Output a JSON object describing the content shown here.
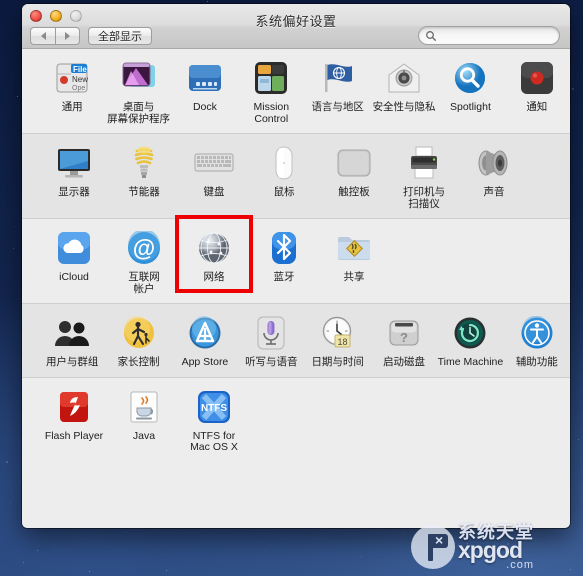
{
  "window": {
    "title": "系统偏好设置",
    "traffic_lights": [
      "close-button",
      "minimize-button",
      "zoom-button"
    ],
    "back_label": "◀",
    "forward_label": "▶",
    "show_all_label": "全部显示",
    "search_placeholder": "",
    "search_value": ""
  },
  "highlight": {
    "color": "#ef0000",
    "target": "网络"
  },
  "rows": [
    {
      "id": "personal",
      "items": [
        {
          "label": "通用",
          "icon": "general-icon"
        },
        {
          "label": "桌面与\n屏幕保护程序",
          "icon": "desktop-screensaver-icon"
        },
        {
          "label": "Dock",
          "icon": "dock-icon"
        },
        {
          "label": "Mission\nControl",
          "icon": "mission-control-icon"
        },
        {
          "label": "语言与地区",
          "icon": "language-region-icon"
        },
        {
          "label": "安全性与隐私",
          "icon": "security-privacy-icon"
        },
        {
          "label": "Spotlight",
          "icon": "spotlight-icon"
        },
        {
          "label": "通知",
          "icon": "notifications-icon"
        }
      ]
    },
    {
      "id": "hardware",
      "items": [
        {
          "label": "显示器",
          "icon": "displays-icon"
        },
        {
          "label": "节能器",
          "icon": "energy-saver-icon"
        },
        {
          "label": "键盘",
          "icon": "keyboard-icon"
        },
        {
          "label": "鼠标",
          "icon": "mouse-icon"
        },
        {
          "label": "触控板",
          "icon": "trackpad-icon"
        },
        {
          "label": "打印机与\n扫描仪",
          "icon": "printers-scanners-icon"
        },
        {
          "label": "声音",
          "icon": "sound-icon"
        }
      ]
    },
    {
      "id": "internet-wireless",
      "items": [
        {
          "label": "iCloud",
          "icon": "icloud-icon"
        },
        {
          "label": "互联网\n帐户",
          "icon": "internet-accounts-icon"
        },
        {
          "label": "网络",
          "icon": "network-icon"
        },
        {
          "label": "蓝牙",
          "icon": "bluetooth-icon"
        },
        {
          "label": "共享",
          "icon": "sharing-icon"
        }
      ]
    },
    {
      "id": "system",
      "items": [
        {
          "label": "用户与群组",
          "icon": "users-groups-icon"
        },
        {
          "label": "家长控制",
          "icon": "parental-controls-icon"
        },
        {
          "label": "App Store",
          "icon": "app-store-icon"
        },
        {
          "label": "听写与语音",
          "icon": "dictation-speech-icon"
        },
        {
          "label": "日期与时间",
          "icon": "date-time-icon"
        },
        {
          "label": "启动磁盘",
          "icon": "startup-disk-icon"
        },
        {
          "label": "Time Machine",
          "icon": "time-machine-icon"
        },
        {
          "label": "辅助功能",
          "icon": "accessibility-icon"
        }
      ]
    },
    {
      "id": "other",
      "items": [
        {
          "label": "Flash Player",
          "icon": "flash-player-icon"
        },
        {
          "label": "Java",
          "icon": "java-icon"
        },
        {
          "label": "NTFS for\nMac OS X",
          "icon": "ntfs-icon"
        }
      ]
    }
  ],
  "watermark": {
    "cn": "系统天堂",
    "en": "xpgod",
    "tld": ".com"
  }
}
